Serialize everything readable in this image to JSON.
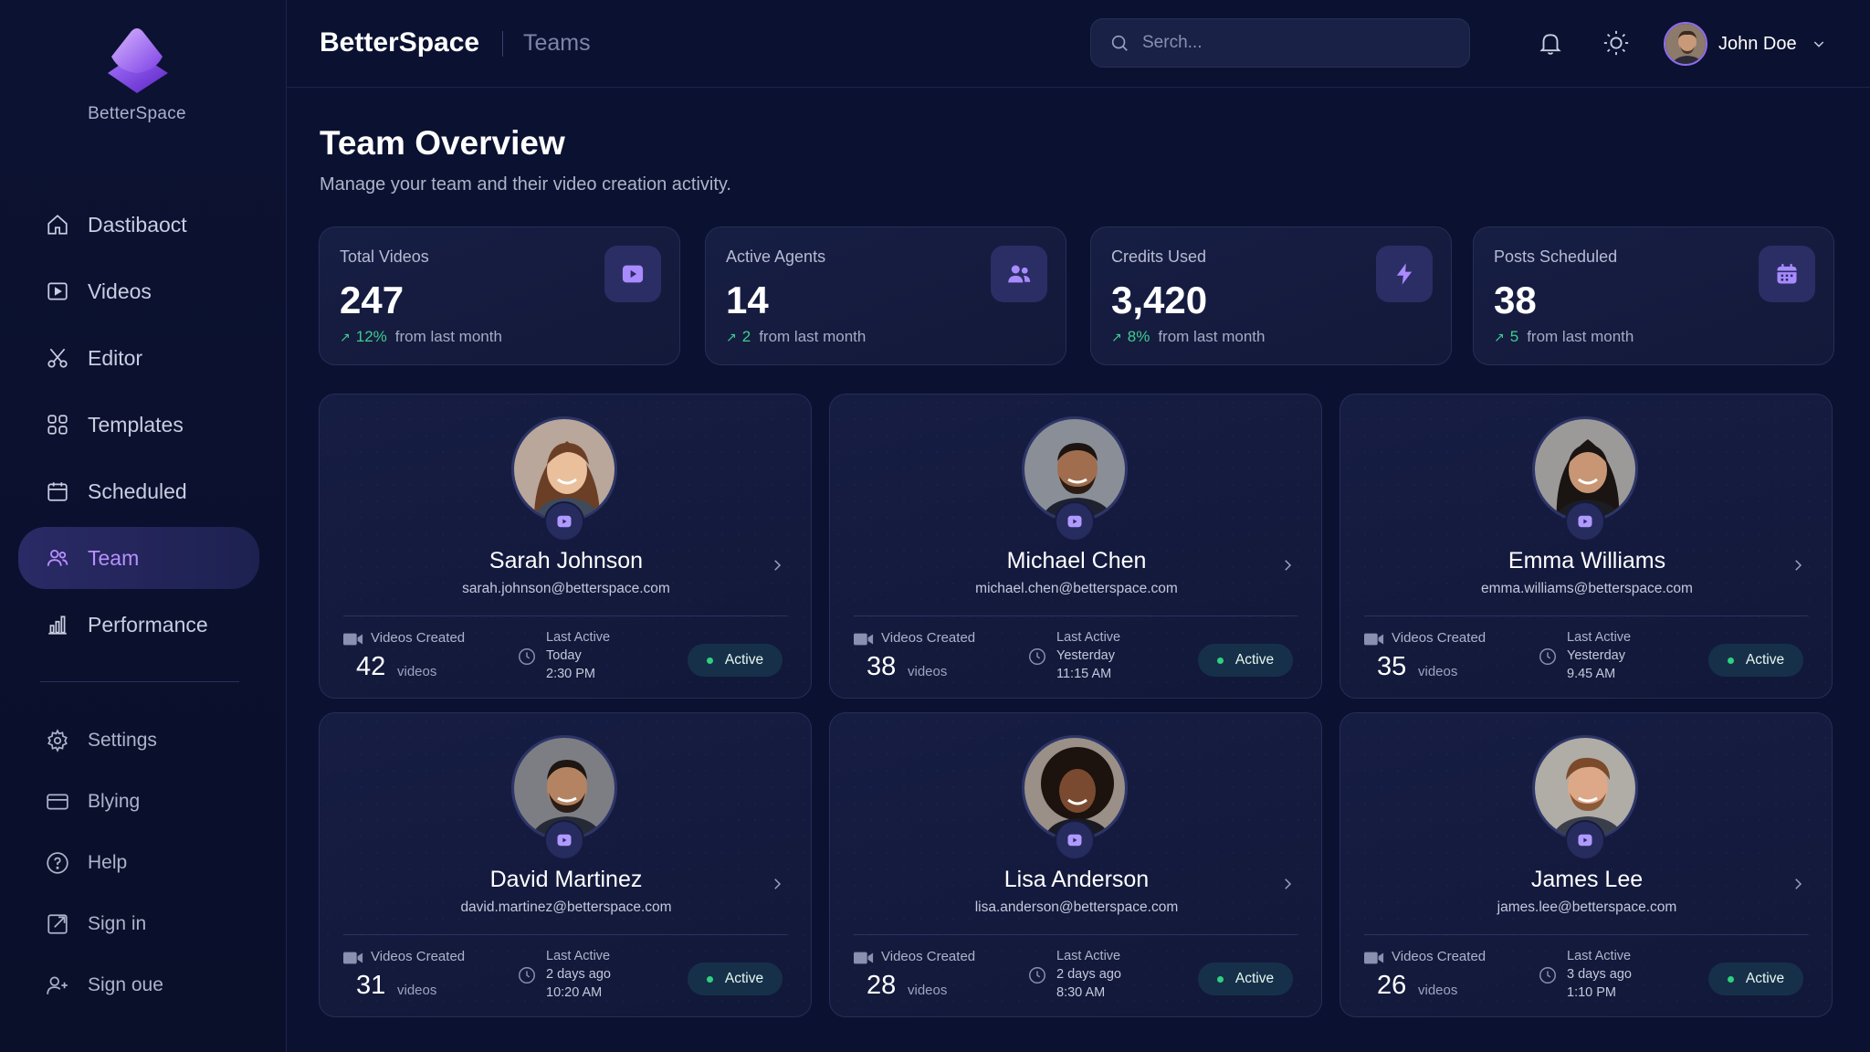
{
  "sidebar": {
    "logo_text": "BetterSpace",
    "items": [
      {
        "label": "Dastibaoct",
        "icon": "home-icon"
      },
      {
        "label": "Videos",
        "icon": "video-icon"
      },
      {
        "label": "Editor",
        "icon": "scissors-icon"
      },
      {
        "label": "Templates",
        "icon": "grid-icon"
      },
      {
        "label": "Scheduled",
        "icon": "calendar-icon"
      },
      {
        "label": "Team",
        "icon": "users-icon",
        "active": true
      },
      {
        "label": "Performance",
        "icon": "bar-chart-icon"
      }
    ],
    "secondary_items": [
      {
        "label": "Settings",
        "icon": "gear-icon"
      },
      {
        "label": "Blying",
        "icon": "credit-card-icon"
      },
      {
        "label": "Help",
        "icon": "help-icon"
      },
      {
        "label": "Sign in",
        "icon": "sign-in-icon"
      },
      {
        "label": "Sign oue",
        "icon": "add-user-icon"
      }
    ]
  },
  "header": {
    "brand": "BetterSpace",
    "page": "Teams",
    "search_placeholder": "Serch...",
    "user_name": "John Doe"
  },
  "main": {
    "title": "Team Overview",
    "subtitle": "Manage your team and their video creation activity."
  },
  "stats": [
    {
      "label": "Total Videos",
      "value": "247",
      "delta": "12%",
      "delta_text": "from last month",
      "icon": "play-icon"
    },
    {
      "label": "Active Agents",
      "value": "14",
      "delta": "2",
      "delta_text": "from last month",
      "icon": "users-icon"
    },
    {
      "label": "Credits Used",
      "value": "3,420",
      "delta": "8%",
      "delta_text": "from last month",
      "icon": "lightning-icon"
    },
    {
      "label": "Posts Scheduled",
      "value": "38",
      "delta": "5",
      "delta_text": "from last month",
      "icon": "calendar-icon"
    }
  ],
  "team": {
    "videos_created_label": "Videos Created",
    "videos_unit": "videos",
    "last_active_label": "Last Active",
    "members": [
      {
        "name": "Sarah Johnson",
        "email": "sarah.johnson@betterspace.com",
        "videos": "42",
        "last_active_day": "Today",
        "last_active_time": "2:30 PM",
        "status": "Active"
      },
      {
        "name": "Michael Chen",
        "email": "michael.chen@betterspace.com",
        "videos": "38",
        "last_active_day": "Yesterday",
        "last_active_time": "11:15 AM",
        "status": "Active"
      },
      {
        "name": "Emma Williams",
        "email": "emma.williams@betterspace.com",
        "videos": "35",
        "last_active_day": "Yesterday",
        "last_active_time": "9.45 AM",
        "status": "Active"
      },
      {
        "name": "David Martinez",
        "email": "david.martinez@betterspace.com",
        "videos": "31",
        "last_active_day": "2 days ago",
        "last_active_time": "10:20 AM",
        "status": "Active"
      },
      {
        "name": "Lisa Anderson",
        "email": "lisa.anderson@betterspace.com",
        "videos": "28",
        "last_active_day": "2 days ago",
        "last_active_time": "8:30 AM",
        "status": "Active"
      },
      {
        "name": "James Lee",
        "email": "james.lee@betterspace.com",
        "videos": "26",
        "last_active_day": "3 days ago",
        "last_active_time": "1:10 PM",
        "status": "Active"
      }
    ]
  },
  "colors": {
    "background": "#0b1130",
    "accent": "#9b6dff",
    "positive": "#3ecf8e",
    "status_dot": "#2ed17f"
  }
}
